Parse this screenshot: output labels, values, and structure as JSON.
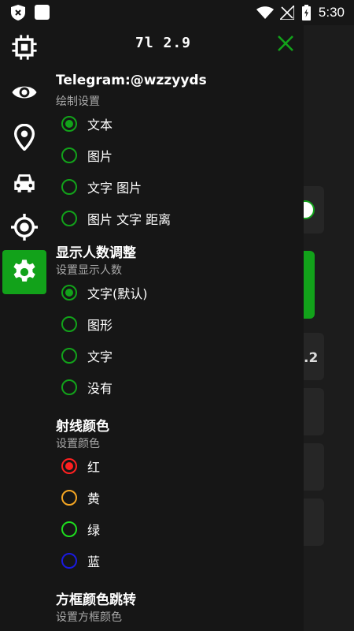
{
  "status_bar": {
    "time": "5:30"
  },
  "sidebar": {
    "items": [
      {
        "icon": "cpu-icon",
        "active": false
      },
      {
        "icon": "eye-icon",
        "active": false
      },
      {
        "icon": "map-pin-icon",
        "active": false
      },
      {
        "icon": "car-icon",
        "active": false
      },
      {
        "icon": "crosshair-icon",
        "active": false
      },
      {
        "icon": "gear-icon",
        "active": true
      }
    ]
  },
  "background": {
    "partial_value": ".2"
  },
  "panel": {
    "title": "7l 2.9",
    "contact": "Telegram:@wzzyyds",
    "draw_settings": {
      "subtitle": "绘制设置",
      "options": [
        "文本",
        "图片",
        "文字 图片",
        "图片 文字 距离"
      ],
      "selected": 0
    },
    "player_count": {
      "title": "显示人数调整",
      "subtitle": "设置显示人数",
      "options": [
        "文字(默认)",
        "图形",
        "文字",
        "没有"
      ],
      "selected": 0
    },
    "ray_color": {
      "title": "射线颜色",
      "subtitle": "设置颜色",
      "options": [
        "红",
        "黄",
        "绿",
        "蓝"
      ],
      "colors": [
        "#ff2020",
        "#f5a623",
        "#1edc1e",
        "#1a1adf"
      ],
      "selected": 0
    },
    "box_color": {
      "title": "方框颜色跳转",
      "subtitle": "设置方框颜色"
    }
  },
  "colors": {
    "accent": "#12a21a",
    "close": "#12a21a"
  }
}
